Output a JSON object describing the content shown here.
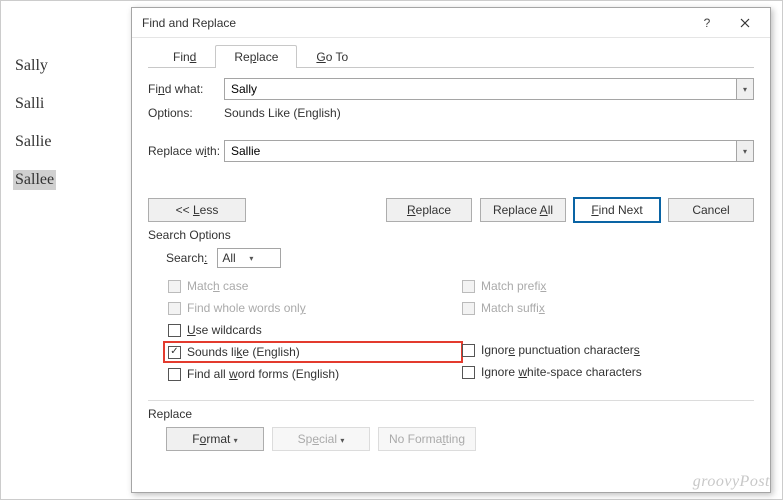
{
  "document": {
    "words": [
      "Sally",
      "Salli",
      "Sallie",
      "Sallee"
    ],
    "highlighted_index": 3
  },
  "dialog": {
    "title": "Find and Replace",
    "tabs": {
      "find": "Find",
      "replace": "Replace",
      "goto": "Go To",
      "active": "replace"
    },
    "find_what_label": "Find what:",
    "find_what_value": "Sally",
    "options_label": "Options:",
    "options_value": "Sounds Like (English)",
    "replace_with_label": "Replace with:",
    "replace_with_value": "Sallie",
    "buttons": {
      "less": "<< Less",
      "replace": "Replace",
      "replace_all": "Replace All",
      "find_next": "Find Next",
      "cancel": "Cancel"
    },
    "search_options_label": "Search Options",
    "search_label": "Search:",
    "search_value": "All",
    "checks": {
      "match_case": {
        "label": "Match case",
        "checked": false,
        "enabled": false
      },
      "whole_words": {
        "label": "Find whole words only",
        "checked": false,
        "enabled": false
      },
      "wildcards": {
        "label": "Use wildcards",
        "checked": false,
        "enabled": true
      },
      "sounds_like": {
        "label": "Sounds like (English)",
        "checked": true,
        "enabled": true
      },
      "word_forms": {
        "label": "Find all word forms (English)",
        "checked": false,
        "enabled": true
      },
      "match_prefix": {
        "label": "Match prefix",
        "checked": false,
        "enabled": false
      },
      "match_suffix": {
        "label": "Match suffix",
        "checked": false,
        "enabled": false
      },
      "ignore_punct": {
        "label": "Ignore punctuation characters",
        "checked": false,
        "enabled": true
      },
      "ignore_space": {
        "label": "Ignore white-space characters",
        "checked": false,
        "enabled": true
      }
    },
    "replace_section_label": "Replace",
    "footer": {
      "format": "Format",
      "special": "Special",
      "no_formatting": "No Formatting"
    }
  },
  "watermark": "groovyPost"
}
